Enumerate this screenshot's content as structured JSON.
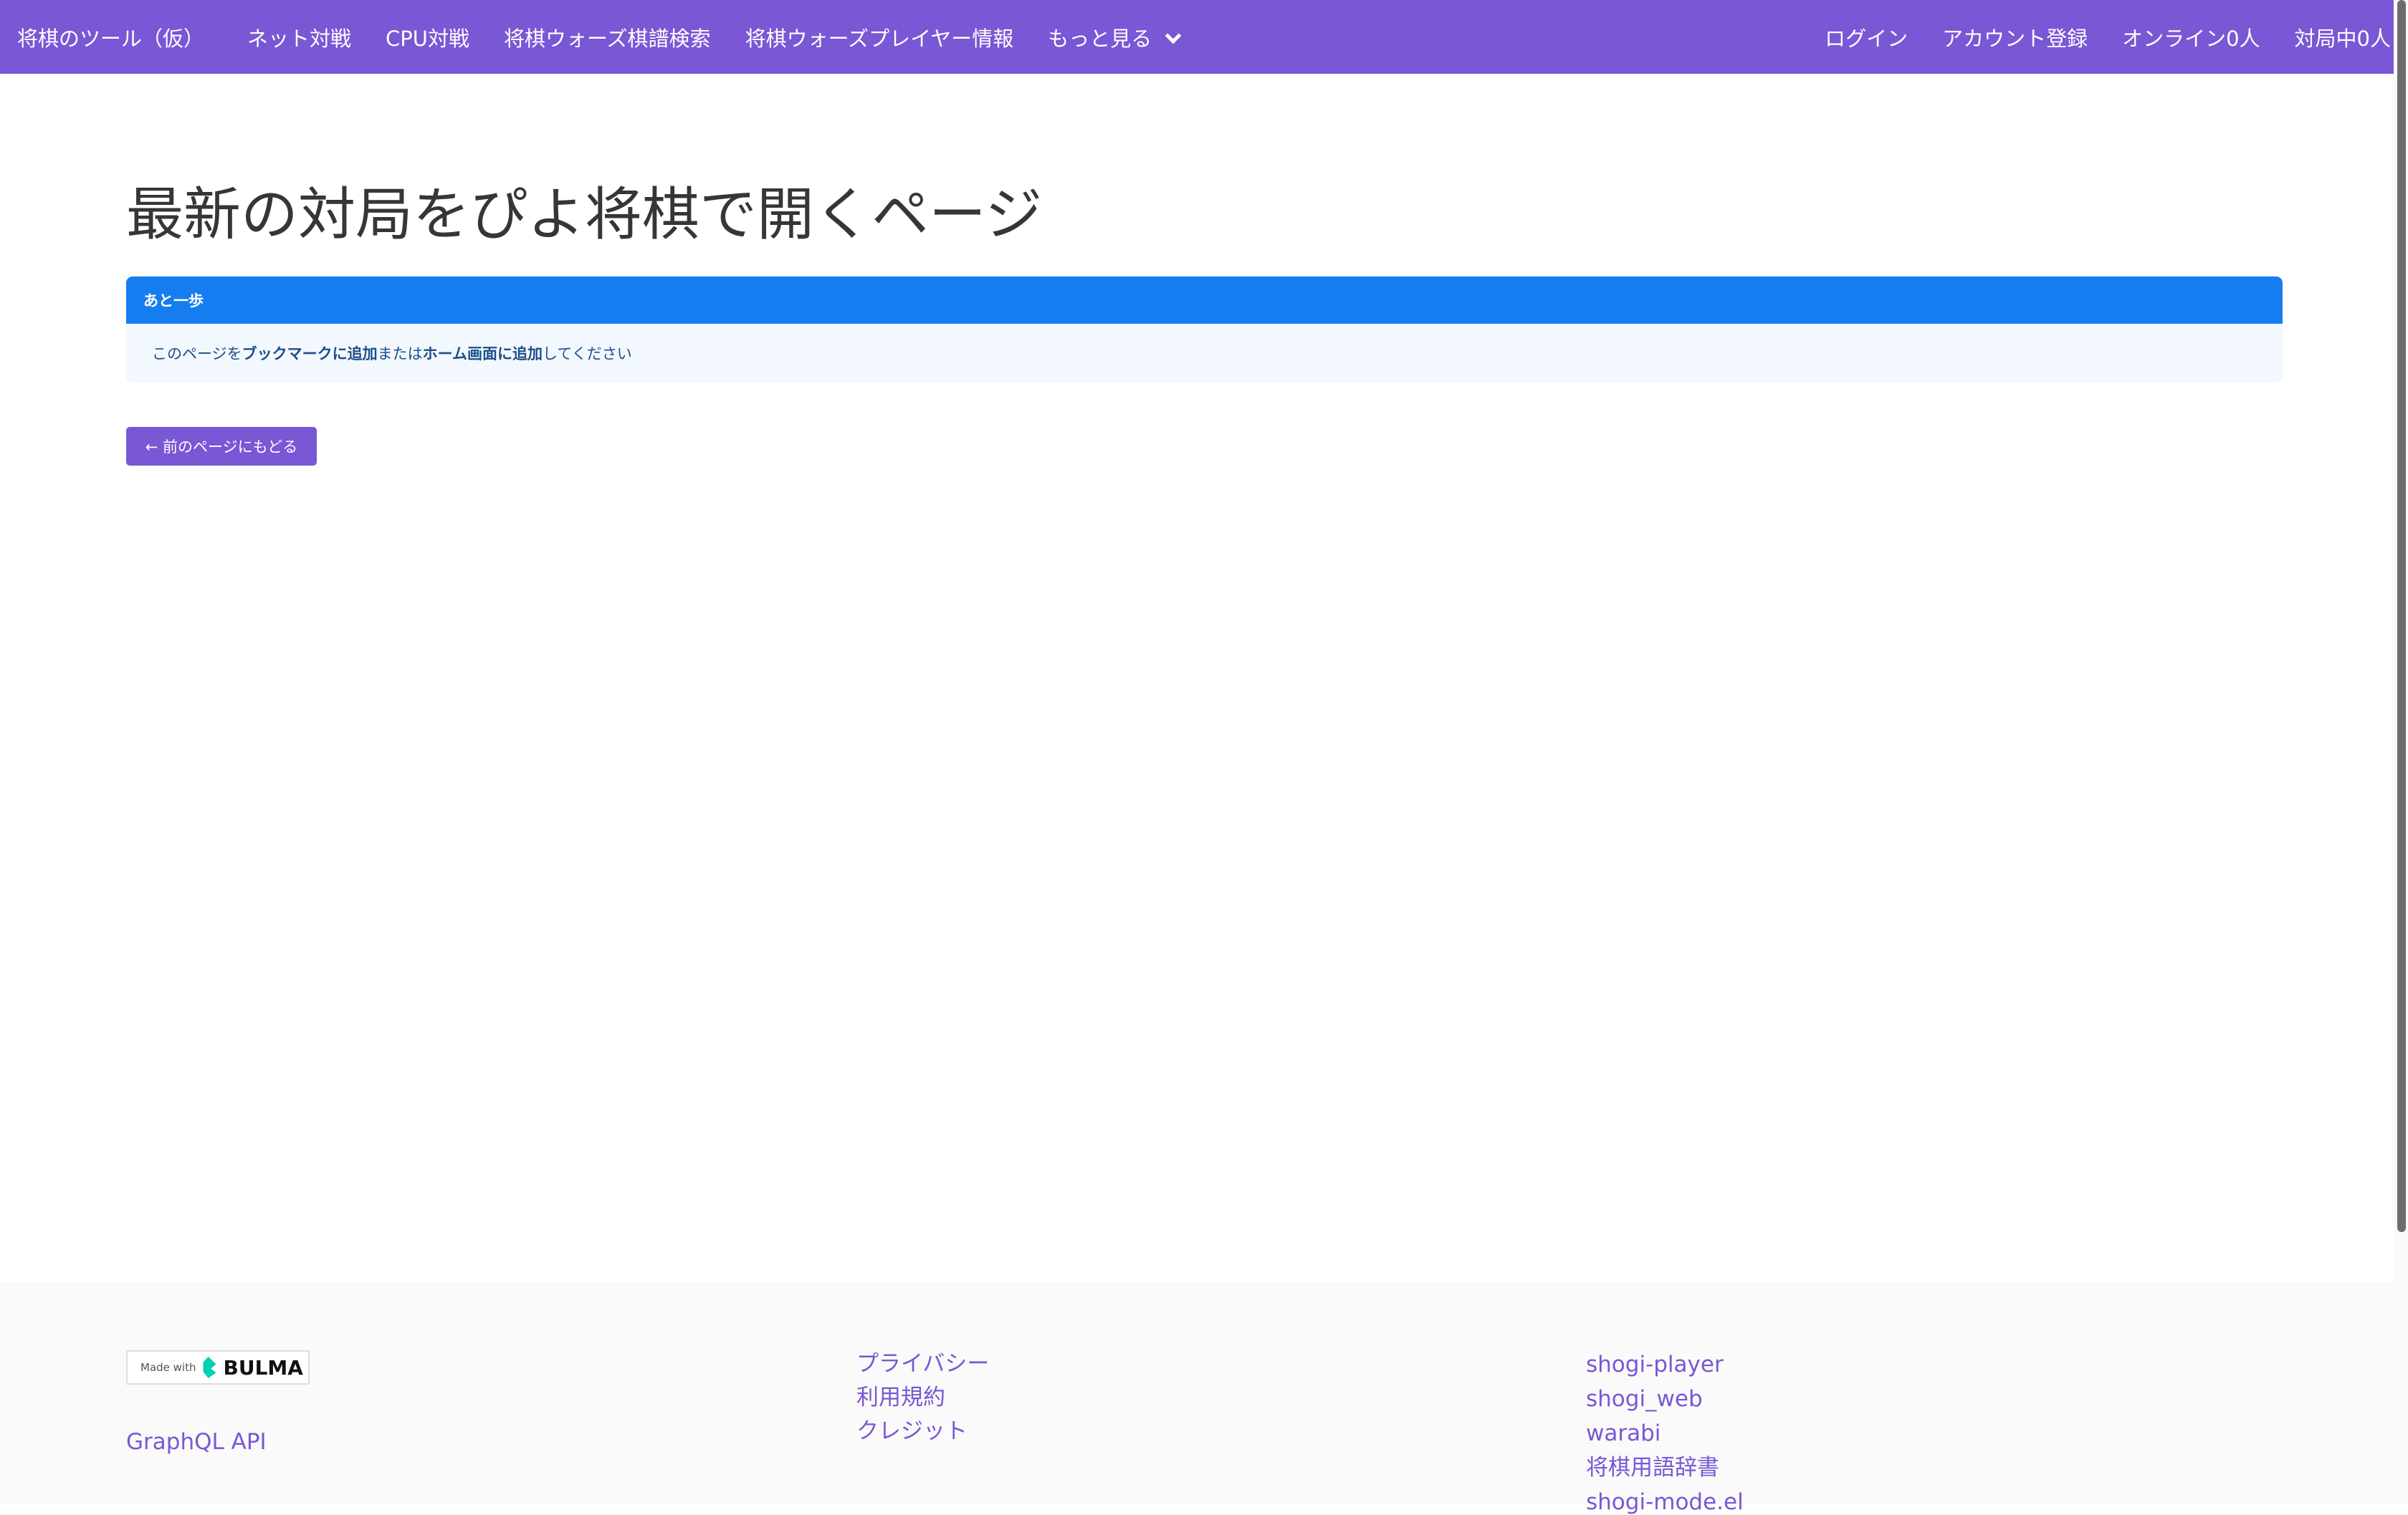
{
  "nav": {
    "brand": "将棋のツール（仮）",
    "items": [
      "ネット対戦",
      "CPU対戦",
      "将棋ウォーズ棋譜検索",
      "将棋ウォーズプレイヤー情報"
    ],
    "more": "もっと見る",
    "right": [
      "ログイン",
      "アカウント登録",
      "オンライン0人",
      "対局中0人"
    ]
  },
  "page": {
    "title": "最新の対局をぴよ将棋で開くページ"
  },
  "message": {
    "header": "あと一歩",
    "parts": [
      "このページを",
      "ブックマークに追加",
      "または",
      "ホーム画面に追加",
      "してください"
    ]
  },
  "back_button": "← 前のページにもどる",
  "footer": {
    "badge_prefix": "Made with",
    "badge_brand": "BULMA",
    "graphql": "GraphQL API",
    "col2": [
      "プライバシー",
      "利用規約",
      "クレジット"
    ],
    "col3": [
      "shogi-player",
      "shogi_web",
      "warabi",
      "将棋用語辞書",
      "shogi-mode.el"
    ]
  },
  "colors": {
    "primary": "#7957d5",
    "info": "#167df0"
  }
}
